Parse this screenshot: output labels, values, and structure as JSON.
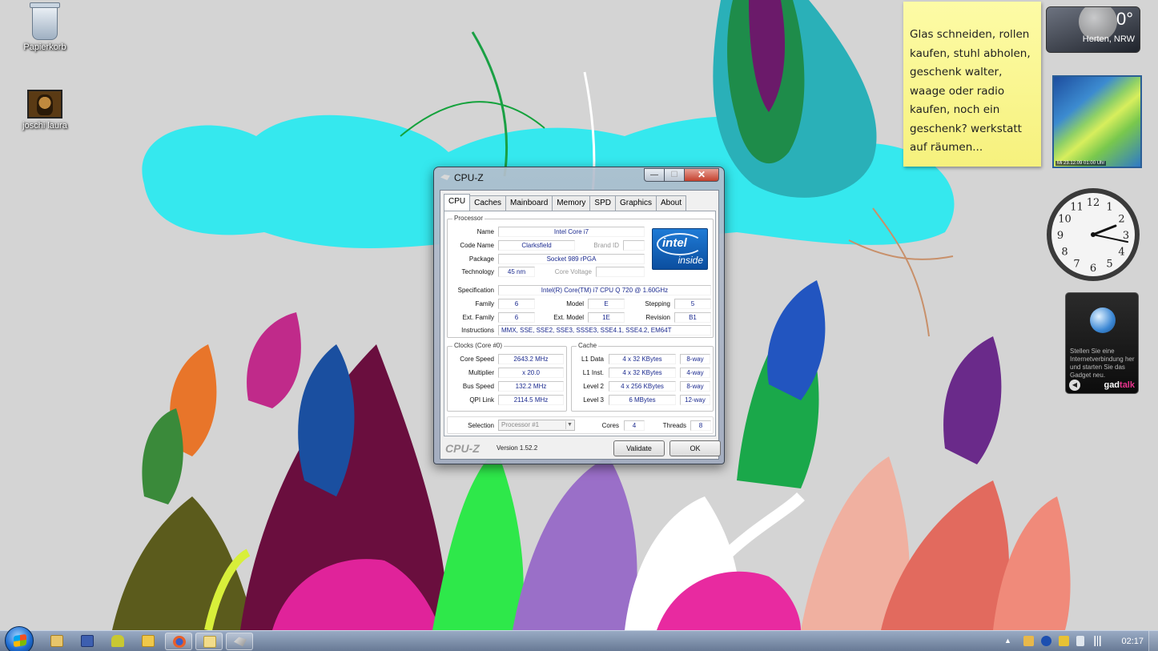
{
  "desktop": {
    "icons": [
      {
        "label": "Papierkorb",
        "icon": "recycle-bin-icon"
      },
      {
        "label": "joschi laura",
        "icon": "photo-file-icon"
      }
    ]
  },
  "sticky_note": {
    "text": "Glas schneiden, rollen kaufen, stuhl abholen, geschenk walter, waage oder radio kaufen, noch ein geschenk? werkstatt auf räumen..."
  },
  "weather": {
    "temperature": "0°",
    "location": "Herten, NRW"
  },
  "radar": {
    "timestamp": "Mi 23.12.09 01:00 Uhr"
  },
  "clock_gadget": {
    "hour": 2,
    "minute": 17,
    "numerals": [
      "12",
      "1",
      "2",
      "3",
      "4",
      "5",
      "6",
      "7",
      "8",
      "9",
      "10",
      "11"
    ]
  },
  "gadtalk": {
    "message": "Stellen Sie eine Internetverbindung her und starten Sie das Gadget neu.",
    "brand_main": "gad",
    "brand_accent": "talk",
    "prev_glyph": "◀"
  },
  "cpuz": {
    "title": "CPU-Z",
    "window_buttons": {
      "minimize": "—",
      "maximize": "☐",
      "close": "✕"
    },
    "tabs": [
      {
        "label": "CPU",
        "active": true
      },
      {
        "label": "Caches",
        "active": false
      },
      {
        "label": "Mainboard",
        "active": false
      },
      {
        "label": "Memory",
        "active": false
      },
      {
        "label": "SPD",
        "active": false
      },
      {
        "label": "Graphics",
        "active": false
      },
      {
        "label": "About",
        "active": false
      }
    ],
    "processor": {
      "legend": "Processor",
      "name_label": "Name",
      "name": "Intel Core i7",
      "codename_label": "Code Name",
      "codename": "Clarksfield",
      "brandid_label": "Brand ID",
      "brandid": "",
      "package_label": "Package",
      "package": "Socket 989 rPGA",
      "technology_label": "Technology",
      "technology": "45 nm",
      "corevoltage_label": "Core Voltage",
      "corevoltage": "",
      "spec_label": "Specification",
      "spec": "Intel(R) Core(TM) i7 CPU       Q 720  @ 1.60GHz",
      "family_label": "Family",
      "family": "6",
      "model_label": "Model",
      "model": "E",
      "stepping_label": "Stepping",
      "stepping": "5",
      "extfamily_label": "Ext. Family",
      "extfamily": "6",
      "extmodel_label": "Ext. Model",
      "extmodel": "1E",
      "revision_label": "Revision",
      "revision": "B1",
      "instructions_label": "Instructions",
      "instructions": "MMX, SSE, SSE2, SSE3, SSSE3, SSE4.1, SSE4.2, EM64T",
      "logo_top": "intel",
      "logo_bottom": "inside"
    },
    "clocks": {
      "legend": "Clocks (Core #0)",
      "core_speed_label": "Core Speed",
      "core_speed": "2643.2 MHz",
      "multiplier_label": "Multiplier",
      "multiplier": "x 20.0",
      "bus_speed_label": "Bus Speed",
      "bus_speed": "132.2 MHz",
      "qpi_label": "QPI Link",
      "qpi": "2114.5 MHz"
    },
    "cache": {
      "legend": "Cache",
      "rows": [
        {
          "label": "L1 Data",
          "size": "4 x 32 KBytes",
          "way": "8-way"
        },
        {
          "label": "L1 Inst.",
          "size": "4 x 32 KBytes",
          "way": "4-way"
        },
        {
          "label": "Level 2",
          "size": "4 x 256 KBytes",
          "way": "8-way"
        },
        {
          "label": "Level 3",
          "size": "6 MBytes",
          "way": "12-way"
        }
      ]
    },
    "selection": {
      "label": "Selection",
      "value": "Processor #1",
      "cores_label": "Cores",
      "cores": "4",
      "threads_label": "Threads",
      "threads": "8"
    },
    "footer": {
      "brand": "CPU-Z",
      "version": "Version 1.52.2",
      "validate": "Validate",
      "ok": "OK"
    }
  },
  "taskbar": {
    "apps": [
      {
        "name": "windows-explorer",
        "icon": "folder-icon"
      },
      {
        "name": "save-tool",
        "icon": "floppy-disk-icon"
      },
      {
        "name": "android-app",
        "icon": "android-icon"
      },
      {
        "name": "photo-folder",
        "icon": "folder-photos-icon"
      },
      {
        "name": "firefox",
        "icon": "firefox-icon"
      },
      {
        "name": "explorer-window",
        "icon": "folder-open-icon"
      },
      {
        "name": "cpu-z",
        "icon": "cpuz-icon"
      }
    ],
    "tray_arrow": "▲",
    "time": "02:17",
    "colors": {
      "taskbar": "#7f95b4",
      "accent": "#1b2a8f"
    }
  }
}
